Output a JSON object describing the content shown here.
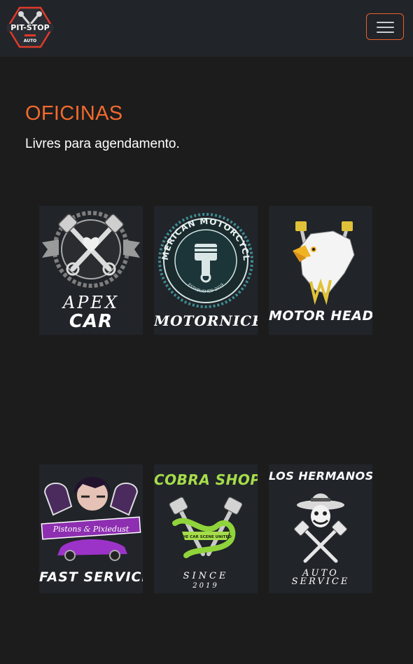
{
  "header": {
    "logo_text": "PIT-STOP",
    "logo_sub": "AUTO",
    "menu_icon": "hamburger-menu-icon",
    "accent_color": "#e8622a"
  },
  "main": {
    "title": "OFICINAS",
    "subtitle": "Livres para agendamento."
  },
  "workshops": [
    {
      "line1": "APEX",
      "line2": "CAR",
      "icon": "crossed-pistons-icon"
    },
    {
      "line1": "AMERICAN MOTORCYCLE",
      "line2": "ESTABLISHED 2019",
      "line3": "MOTORNICE",
      "icon": "piston-gear-badge-icon"
    },
    {
      "line1": "MOTOR HEAD",
      "icon": "eagle-pistons-icon"
    },
    {
      "line1": "Pistons & Pixiedust",
      "line2": "FAST SERVICE",
      "icon": "pixie-car-icon"
    },
    {
      "line1": "COBRA SHOP",
      "line2": "THE CAR SCENE UNITED",
      "line3": "SINCE",
      "line4": "2019",
      "icon": "snake-pistons-icon"
    },
    {
      "line1": "LOS HERMANOS",
      "line2": "AUTO",
      "line3": "SERVICE",
      "icon": "sombrero-skull-pistons-icon"
    }
  ]
}
